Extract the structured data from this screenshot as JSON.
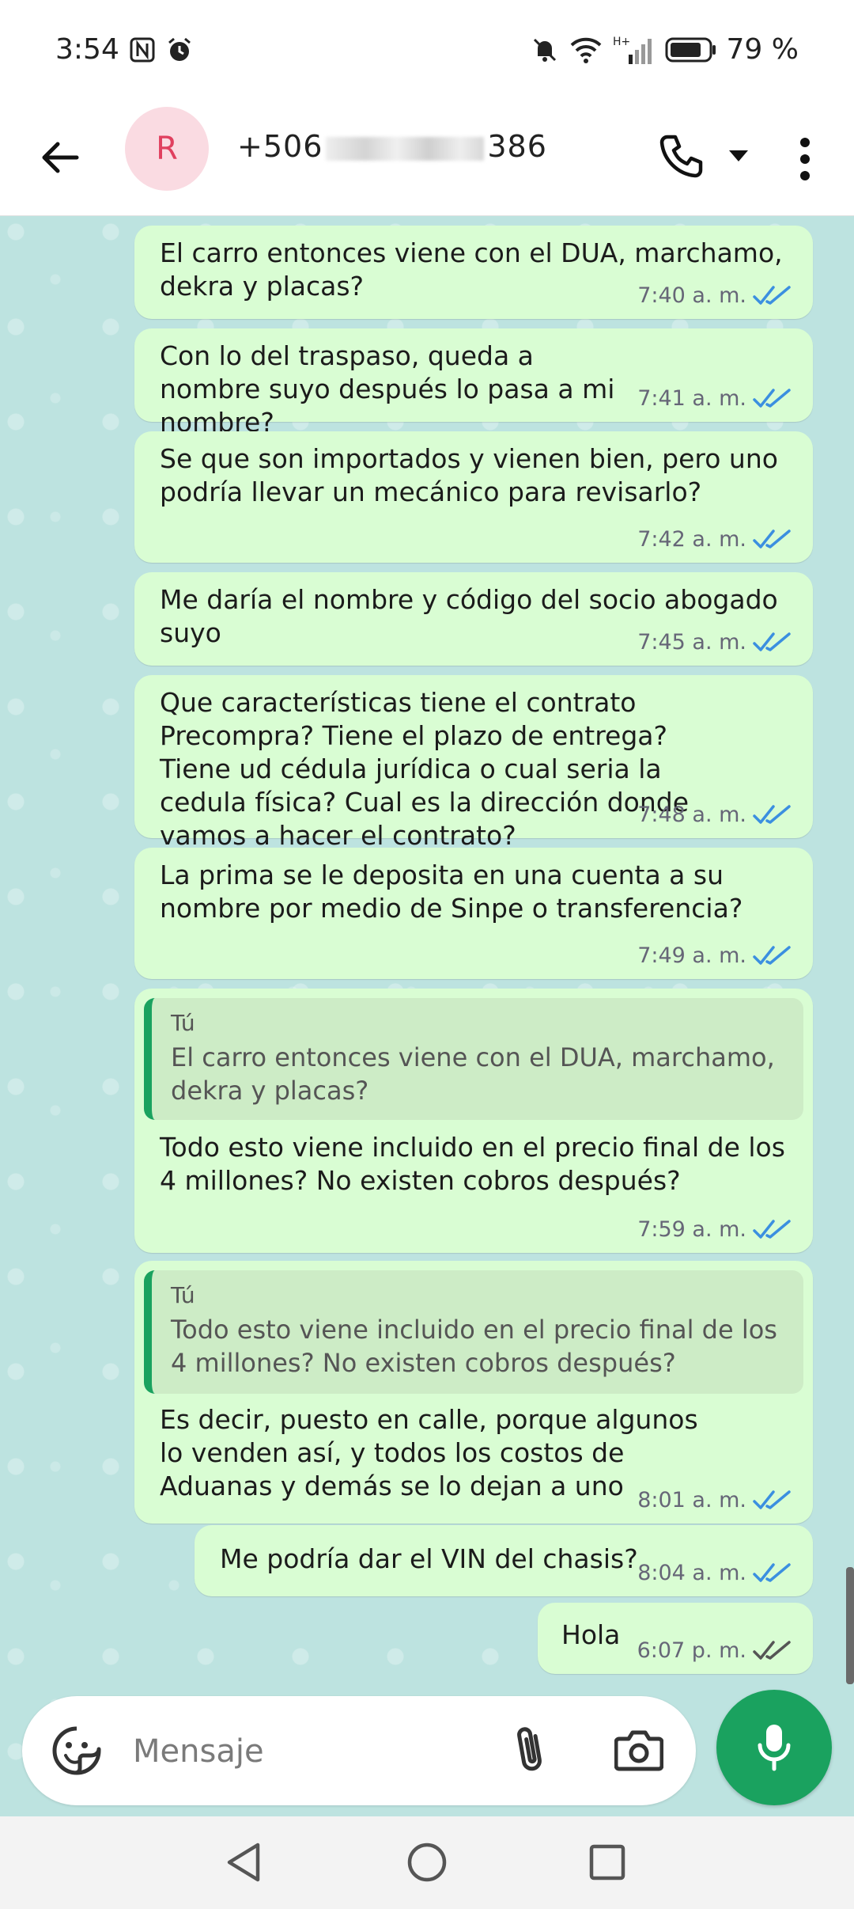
{
  "status_bar": {
    "time": "3:54",
    "battery": "79 %",
    "icons": [
      "nfc-icon",
      "alarm-icon",
      "mute-icon",
      "wifi-icon",
      "signal-icon",
      "battery-icon"
    ]
  },
  "header": {
    "avatar_initial": "R",
    "number_prefix": "+506",
    "number_suffix": "386"
  },
  "messages": [
    {
      "text": "El carro entonces viene con el DUA, marchamo, dekra y placas?",
      "time": "7:40 a. m.",
      "status": "read"
    },
    {
      "text": "Con lo del traspaso, queda a nombre suyo después lo pasa a mi nombre?",
      "time": "7:41 a. m.",
      "status": "read"
    },
    {
      "text": "Se que son importados y vienen bien, pero uno podría llevar un mecánico para revisarlo?",
      "time": "7:42 a. m.",
      "status": "read"
    },
    {
      "text": "Me daría el nombre y código del socio abogado suyo",
      "time": "7:45 a. m.",
      "status": "read"
    },
    {
      "text": "Que características tiene el contrato Precompra? Tiene el plazo de entrega? Tiene ud cédula jurídica o cual seria la cedula física? Cual es la dirección donde vamos a hacer el contrato?",
      "time": "7:48 a. m.",
      "status": "read"
    },
    {
      "text": "La prima se le deposita en una cuenta a su nombre por medio de Sinpe o transferencia?",
      "time": "7:49 a. m.",
      "status": "read"
    },
    {
      "quote_author": "Tú",
      "quote_text": "El carro entonces viene con el DUA, marchamo, dekra y placas?",
      "text": "Todo esto viene incluido en el precio final de los 4 millones? No existen cobros después?",
      "time": "7:59 a. m.",
      "status": "read"
    },
    {
      "quote_author": "Tú",
      "quote_text": "Todo esto viene incluido en el precio final de los 4 millones? No existen cobros después?",
      "text": "Es decir, puesto en calle, porque algunos lo venden así, y todos los costos de Aduanas y demás se lo dejan a uno",
      "time": "8:01 a. m.",
      "status": "read"
    },
    {
      "text": "Me podría dar el VIN del chasis?",
      "time": "8:04 a. m.",
      "status": "read"
    },
    {
      "text": "Hola",
      "time": "6:07 p. m.",
      "status": "delivered"
    }
  ],
  "composer": {
    "placeholder": "Mensaje"
  },
  "colors": {
    "accent": "#1aa25f",
    "bubble": "#d9fdd3",
    "chat_bg": "#bde3e0",
    "read_tick": "#3b8fe0",
    "delivered_tick": "#555555"
  }
}
